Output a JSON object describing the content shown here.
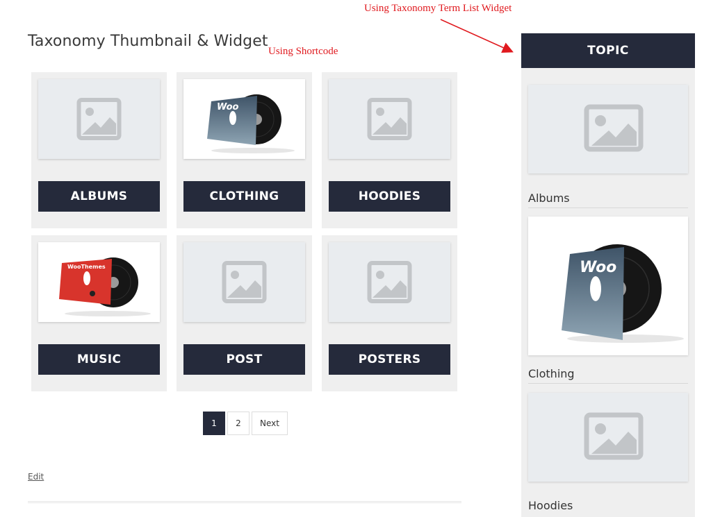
{
  "page": {
    "title": "Taxonomy Thumbnail & Widget"
  },
  "annotations": {
    "shortcode": "Using Shortcode",
    "widget": "Using Taxonomy Term List Widget"
  },
  "terms": [
    {
      "label": "ALBUMS",
      "thumb": "placeholder-image-icon"
    },
    {
      "label": "CLOTHING",
      "thumb": "vinyl-record-woo"
    },
    {
      "label": "HOODIES",
      "thumb": "placeholder-image-icon"
    },
    {
      "label": "MUSIC",
      "thumb": "vinyl-record-woothemes"
    },
    {
      "label": "POST",
      "thumb": "placeholder-image-icon"
    },
    {
      "label": "POSTERS",
      "thumb": "placeholder-image-icon"
    }
  ],
  "album_text": {
    "woo": "Woo",
    "woothemes": "WooThemes"
  },
  "pagination": {
    "pages": [
      "1",
      "2"
    ],
    "current": "1",
    "next": "Next"
  },
  "edit_link": "Edit",
  "sidebar": {
    "title": "TOPIC",
    "items": [
      {
        "label": "Albums",
        "thumb": "placeholder-image-icon"
      },
      {
        "label": "Clothing",
        "thumb": "vinyl-record-woo"
      },
      {
        "label": "Hoodies",
        "thumb": "placeholder-image-icon"
      }
    ]
  },
  "colors": {
    "dark_navy": "#252a3b",
    "card_bg": "#efefef",
    "placeholder_bg": "#e9ecef",
    "annotation_red": "#e0191e"
  }
}
